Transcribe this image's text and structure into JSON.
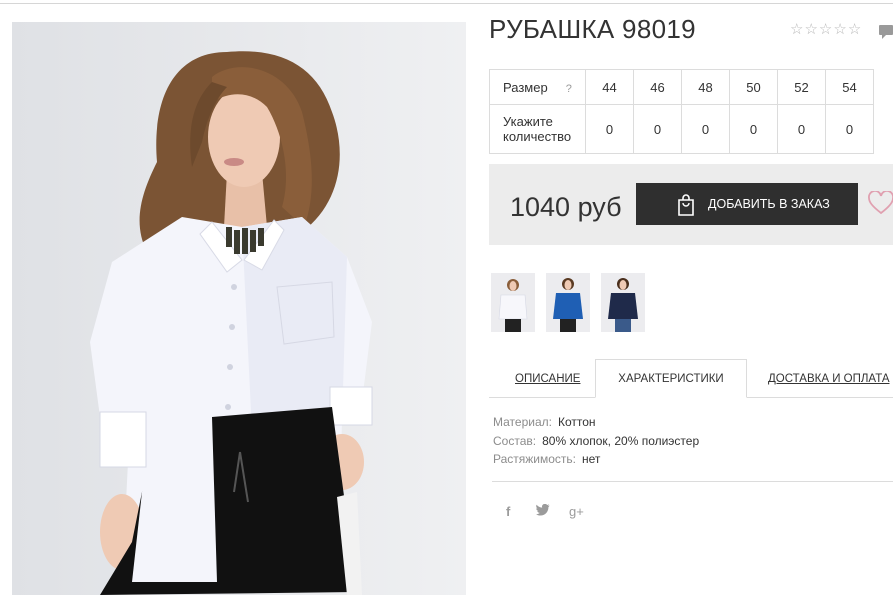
{
  "product": {
    "title": "РУБАШКА 98019",
    "rating_stars": [
      "☆",
      "☆",
      "☆",
      "☆",
      "☆"
    ],
    "rating_value": 0
  },
  "sizes": {
    "size_label": "Размер",
    "help_mark": "?",
    "quantity_label": "Укажите количество",
    "values": [
      "44",
      "46",
      "48",
      "50",
      "52",
      "54"
    ],
    "quantities": [
      "0",
      "0",
      "0",
      "0",
      "0",
      "0"
    ]
  },
  "purchase": {
    "price": "1040 руб",
    "order_label": "ДОБАВИТЬ В ЗАКАЗ"
  },
  "thumbnails": [
    {
      "name": "thumb-white-shirt",
      "color": "#f3f3f6"
    },
    {
      "name": "thumb-blue-shirt",
      "color": "#1f5fb4"
    },
    {
      "name": "thumb-navy-shirt",
      "color": "#1f2a4a"
    }
  ],
  "tabs": {
    "description": "ОПИСАНИЕ",
    "characteristics": "ХАРАКТЕРИСТИКИ",
    "delivery": "ДОСТАВКА И ОПЛАТА"
  },
  "specs": {
    "material_key": "Материал:",
    "material_value": "Коттон",
    "composition_key": "Состав:",
    "composition_value": "80% хлопок, 20% полиэстер",
    "stretch_key": "Растяжимость:",
    "stretch_value": "нет"
  },
  "social": {
    "facebook": "f",
    "twitter": "t",
    "gplus": "g+"
  },
  "colors": {
    "button_bg": "#2f2f2f",
    "price_box_bg": "#ececec",
    "heart": "#e0a0b0",
    "muted_text": "#8c8c8c"
  }
}
